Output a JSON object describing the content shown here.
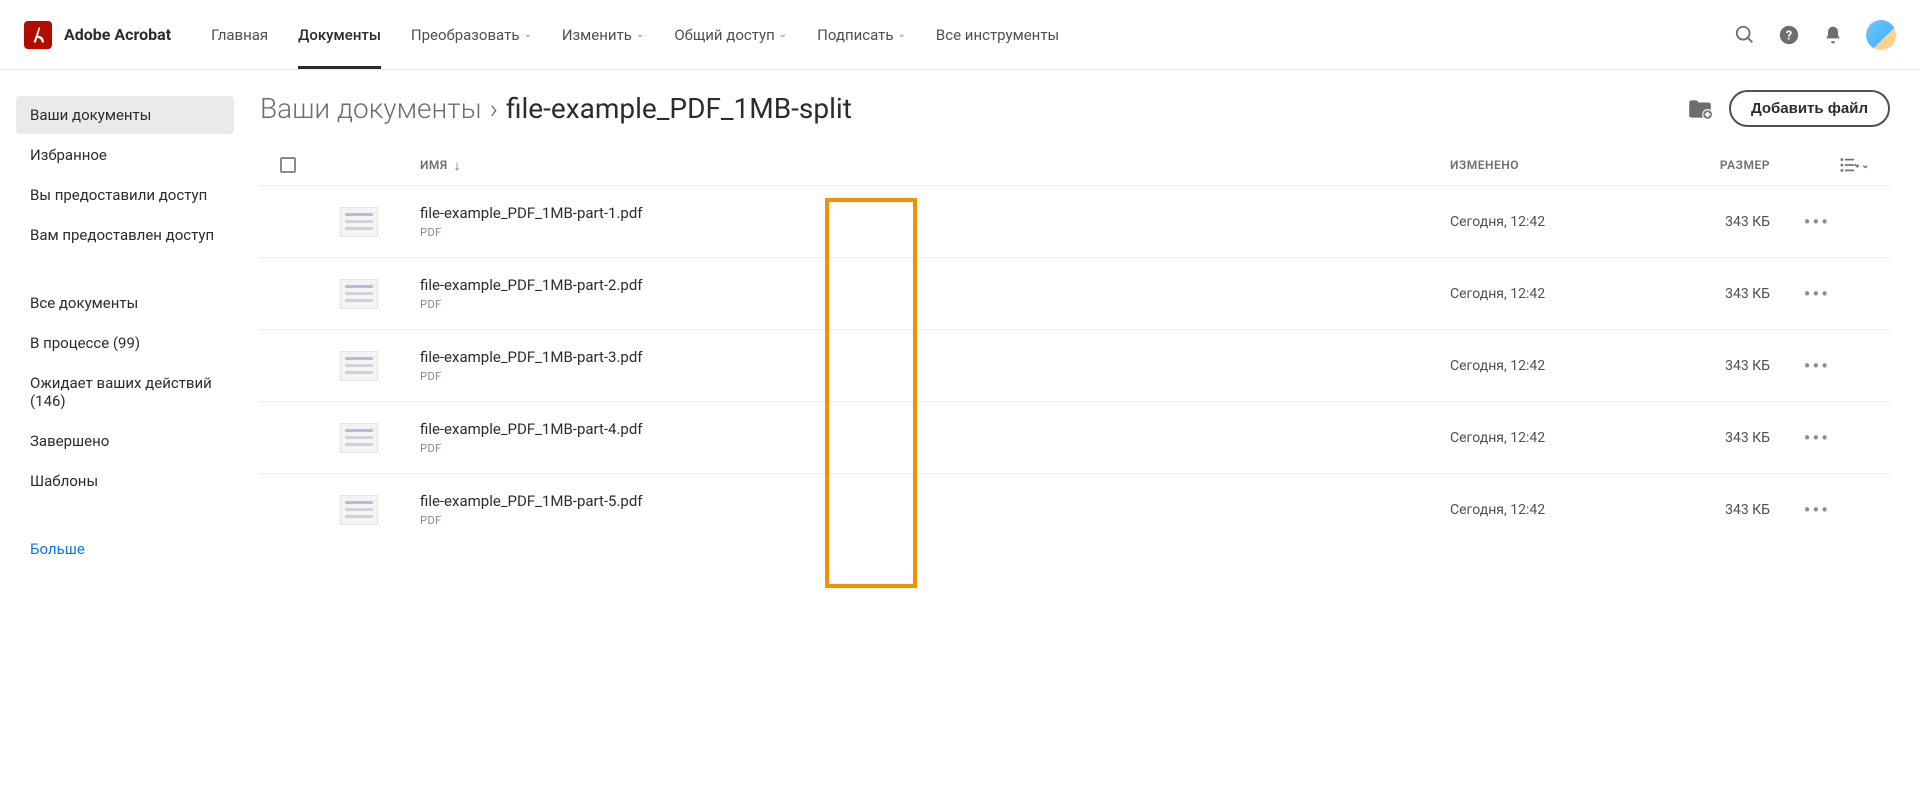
{
  "brand": "Adobe Acrobat",
  "topnav": [
    {
      "label": "Главная",
      "active": false,
      "caret": false
    },
    {
      "label": "Документы",
      "active": true,
      "caret": false
    },
    {
      "label": "Преобразовать",
      "active": false,
      "caret": true
    },
    {
      "label": "Изменить",
      "active": false,
      "caret": true
    },
    {
      "label": "Общий доступ",
      "active": false,
      "caret": true
    },
    {
      "label": "Подписать",
      "active": false,
      "caret": true
    },
    {
      "label": "Все инструменты",
      "active": false,
      "caret": false
    }
  ],
  "sidebar": {
    "group1": [
      {
        "label": "Ваши документы",
        "active": true
      },
      {
        "label": "Избранное",
        "active": false
      },
      {
        "label": "Вы предоставили доступ",
        "active": false
      },
      {
        "label": "Вам предоставлен доступ",
        "active": false
      }
    ],
    "group2": [
      {
        "label": "Все документы",
        "active": false
      },
      {
        "label": "В процессе (99)",
        "active": false
      },
      {
        "label": "Ожидает ваших действий (146)",
        "active": false
      },
      {
        "label": "Завершено",
        "active": false
      },
      {
        "label": "Шаблоны",
        "active": false
      }
    ],
    "more": "Больше"
  },
  "breadcrumb": {
    "root": "Ваши документы",
    "current": "file-example_PDF_1MB-split"
  },
  "add_file_label": "Добавить файл",
  "columns": {
    "name": "ИМЯ",
    "modified": "ИЗМЕНЕНО",
    "size": "РАЗМЕР"
  },
  "files": [
    {
      "name": "file-example_PDF_1MB-part-1.pdf",
      "type": "PDF",
      "modified": "Сегодня, 12:42",
      "size": "343 КБ"
    },
    {
      "name": "file-example_PDF_1MB-part-2.pdf",
      "type": "PDF",
      "modified": "Сегодня, 12:42",
      "size": "343 КБ"
    },
    {
      "name": "file-example_PDF_1MB-part-3.pdf",
      "type": "PDF",
      "modified": "Сегодня, 12:42",
      "size": "343 КБ"
    },
    {
      "name": "file-example_PDF_1MB-part-4.pdf",
      "type": "PDF",
      "modified": "Сегодня, 12:42",
      "size": "343 КБ"
    },
    {
      "name": "file-example_PDF_1MB-part-5.pdf",
      "type": "PDF",
      "modified": "Сегодня, 12:42",
      "size": "343 КБ"
    }
  ]
}
